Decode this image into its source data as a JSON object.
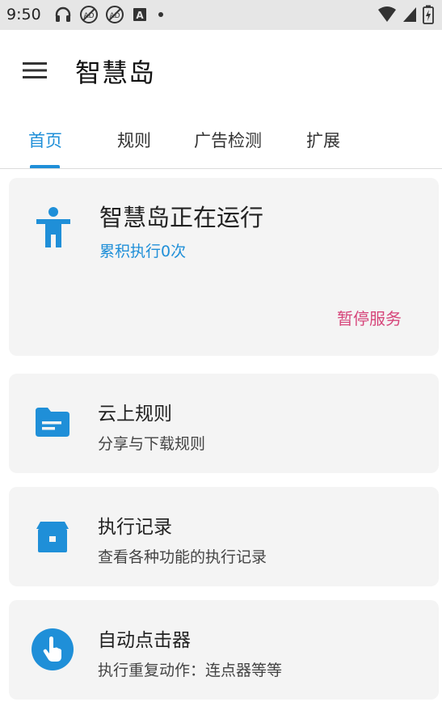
{
  "status_bar": {
    "time": "9:50"
  },
  "app_bar": {
    "title": "智慧岛"
  },
  "tabs": [
    {
      "label": "首页",
      "active": true
    },
    {
      "label": "规则",
      "active": false
    },
    {
      "label": "广告检测",
      "active": false
    },
    {
      "label": "扩展",
      "active": false
    }
  ],
  "service_card": {
    "title": "智慧岛正在运行",
    "subtitle": "累积执行0次",
    "action_label": "暂停服务",
    "icon": "accessibility-icon"
  },
  "feature_cards": [
    {
      "title": "云上规则",
      "subtitle": "分享与下载规则",
      "icon": "folder-icon"
    },
    {
      "title": "执行记录",
      "subtitle": "查看各种功能的执行记录",
      "icon": "archive-icon"
    },
    {
      "title": "自动点击器",
      "subtitle": "执行重复动作：连点器等等",
      "icon": "touch-icon"
    }
  ],
  "colors": {
    "accent": "#1f8fd8",
    "pause": "#d6457a",
    "card_bg": "#f4f4f4",
    "status_bar_bg": "#e6e6e6"
  }
}
